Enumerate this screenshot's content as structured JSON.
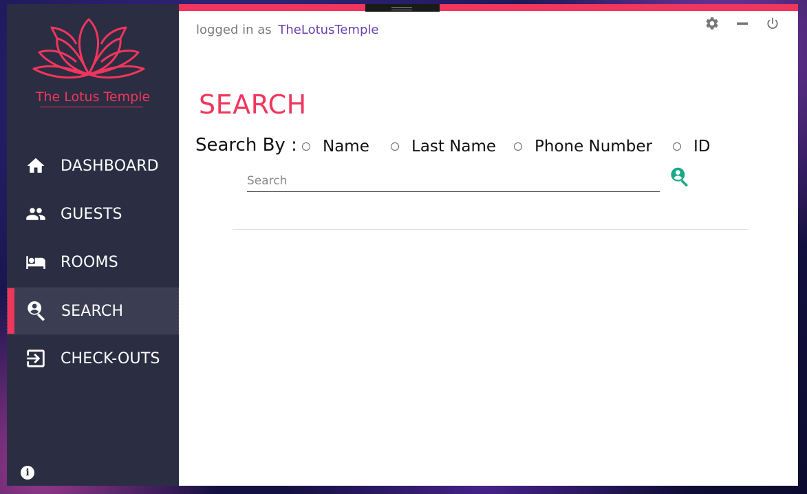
{
  "app": {
    "name": "The Lotus Temple",
    "brand_color": "#f0365c",
    "sidebar_color": "#2b2d42"
  },
  "header": {
    "logged_prefix": "logged in as",
    "username": "TheLotusTemple",
    "tools": [
      "gear-icon",
      "minimize-icon",
      "power-icon"
    ]
  },
  "sidebar": {
    "items": [
      {
        "label": "DASHBOARD",
        "icon": "home-icon"
      },
      {
        "label": "GUESTS",
        "icon": "people-icon"
      },
      {
        "label": "ROOMS",
        "icon": "bed-icon"
      },
      {
        "label": "SEARCH",
        "icon": "person-search-icon",
        "active": true
      },
      {
        "label": "CHECK-OUTS",
        "icon": "exit-icon"
      }
    ]
  },
  "main": {
    "title": "SEARCH",
    "search_by_label": "Search By :",
    "options": [
      "Name",
      "Last Name",
      "Phone Number",
      "ID"
    ],
    "search": {
      "placeholder": "Search",
      "value": ""
    }
  }
}
